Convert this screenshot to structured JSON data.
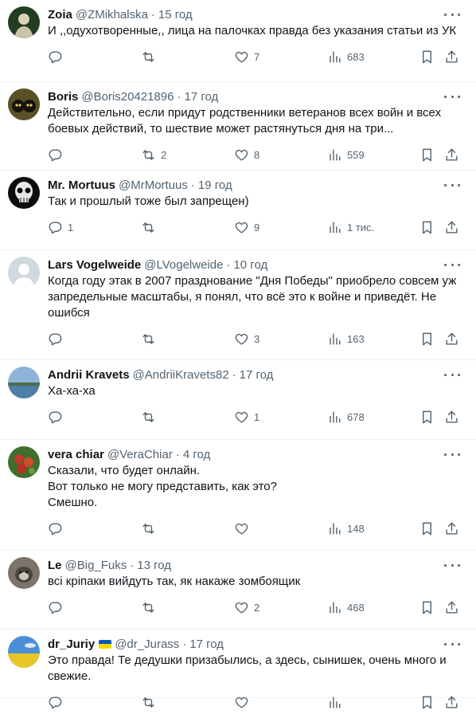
{
  "tweets": [
    {
      "name": "Zoia",
      "handle": "@ZMikhalska",
      "time": "15 год",
      "text": "И ,,одухотворенные,, лица на палочках правда без указания статьи из УК",
      "replies": "",
      "retweets": "",
      "likes": "7",
      "views": "683",
      "avatar": "portrait-dark-icon",
      "height": 103
    },
    {
      "name": "Boris",
      "handle": "@Boris20421896",
      "time": "17 год",
      "text": "Действительно, если придут родственники ветеранов всех войн и всех боевых действий, то шествие может растянуться дня на три...",
      "replies": "",
      "retweets": "2",
      "likes": "8",
      "views": "559",
      "avatar": "cats-icon",
      "height": 111
    },
    {
      "name": "Mr. Mortuus",
      "handle": "@MrMortuus",
      "time": "19 год",
      "text": "Так и прошлый тоже был запрещен)",
      "replies": "1",
      "retweets": "",
      "likes": "9",
      "views": "1 тис.",
      "avatar": "skull-icon",
      "height": 100
    },
    {
      "name": "Lars Vogelweide",
      "handle": "@LVogelweide",
      "time": "10 год",
      "text": "Когда году этак в 2007 празднование \"Дня Победы\" приобрело совсем уж запредельные масштабы, я понял, что всё это к войне и приведёт. Не ошибся",
      "replies": "",
      "retweets": "",
      "likes": "3",
      "views": "163",
      "avatar": "default-avatar-icon",
      "height": 138
    },
    {
      "name": "Andrii Kravets",
      "handle": "@AndriiKravets82",
      "time": "17 год",
      "text": "Ха-ха-ха",
      "replies": "",
      "retweets": "",
      "likes": "1",
      "views": "678",
      "avatar": "landscape-icon",
      "height": 100
    },
    {
      "name": "vera chiar",
      "handle": "@VeraChiar",
      "time": "4 год",
      "text": "Сказали, что будет онлайн.\nВот только не могу представить, как это?\nСмешно.",
      "replies": "",
      "retweets": "",
      "likes": "",
      "views": "148",
      "avatar": "apples-icon",
      "height": 139
    },
    {
      "name": "Le",
      "handle": "@Big_Fuks",
      "time": "13 год",
      "text": "всі кріпаки вийдуть так, як накаже зомбоящик",
      "replies": "",
      "retweets": "",
      "likes": "2",
      "views": "468",
      "avatar": "animal-icon",
      "height": 99
    },
    {
      "name": "dr_Juriy",
      "handle": "@dr_Jurass",
      "time": "17 год",
      "text": "Это правда! Те дедушки призабылись, а здесь, сынишек, очень много и свежие.",
      "replies": "",
      "retweets": "",
      "likes": "",
      "views": "",
      "avatar": "field-icon",
      "height": 86,
      "flag": true
    }
  ],
  "colors": {
    "text": "#0f1419",
    "secondary": "#536471",
    "divider": "#eff3f4",
    "flag_blue": "#0057b7",
    "flag_yellow": "#ffd700"
  }
}
